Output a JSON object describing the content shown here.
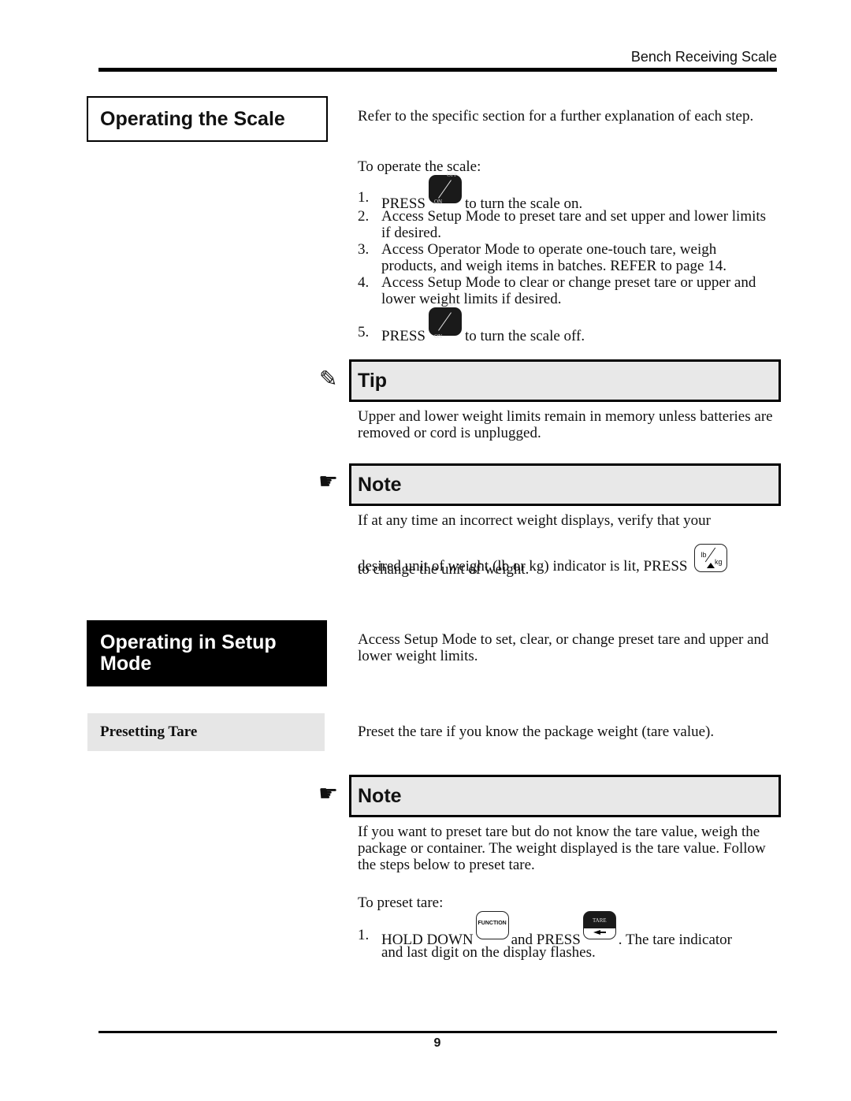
{
  "header": {
    "title": "Bench Receiving Scale"
  },
  "section1": {
    "heading": "Operating the Scale",
    "intro": "Refer to the specific section for a further explanation of each step.",
    "lead": "To operate the scale:",
    "steps": [
      {
        "num": "1.",
        "pre": "PRESS",
        "post": "to turn the scale on."
      },
      {
        "num": "2.",
        "text": "Access Setup Mode to preset tare and set upper and lower limits if desired."
      },
      {
        "num": "3.",
        "text": "Access Operator Mode to operate one-touch tare, weigh products, and weigh items in batches. REFER to page 14."
      },
      {
        "num": "4.",
        "text": "Access Setup Mode to clear or change preset tare or upper and lower weight limits if desired."
      },
      {
        "num": "5.",
        "pre": "PRESS",
        "post": "to turn the scale off."
      }
    ],
    "onoff_key": {
      "top": "ON",
      "bottom": "OFF"
    },
    "tip": {
      "title": "Tip",
      "icon": "pencil-icon",
      "text": "Upper and lower weight limits remain in memory unless batteries are removed or cord is unplugged."
    },
    "note": {
      "title": "Note",
      "icon": "pointing-hand-icon",
      "text1": "If at any time an incorrect weight displays, verify that your",
      "text2": "desired unit of weight (lb or kg) indicator is lit, PRESS",
      "text3": "to change the unit of weight.",
      "unit_key": {
        "top": "lb",
        "bottom": "kg"
      }
    }
  },
  "section2": {
    "heading": "Operating in Setup Mode",
    "intro": "Access Setup Mode to set, clear, or change preset tare and upper and lower weight limits.",
    "subheading": "Presetting Tare",
    "sub_intro": "Preset the tare if you know the package weight (tare value).",
    "note": {
      "title": "Note",
      "icon": "pointing-hand-icon",
      "text": "If you want to preset tare but do not know the tare value, weigh the package or container. The weight displayed is the tare value. Follow the steps below to preset tare."
    },
    "lead": "To preset tare:",
    "step1": {
      "num": "1.",
      "a": "HOLD DOWN",
      "b": "and PRESS",
      "c": ". The tare indicator",
      "d": "and last digit on the display flashes."
    },
    "function_key": {
      "label": "FUNCTION"
    },
    "tare_key": {
      "label": "TARE"
    }
  },
  "footer": {
    "page": "9"
  }
}
